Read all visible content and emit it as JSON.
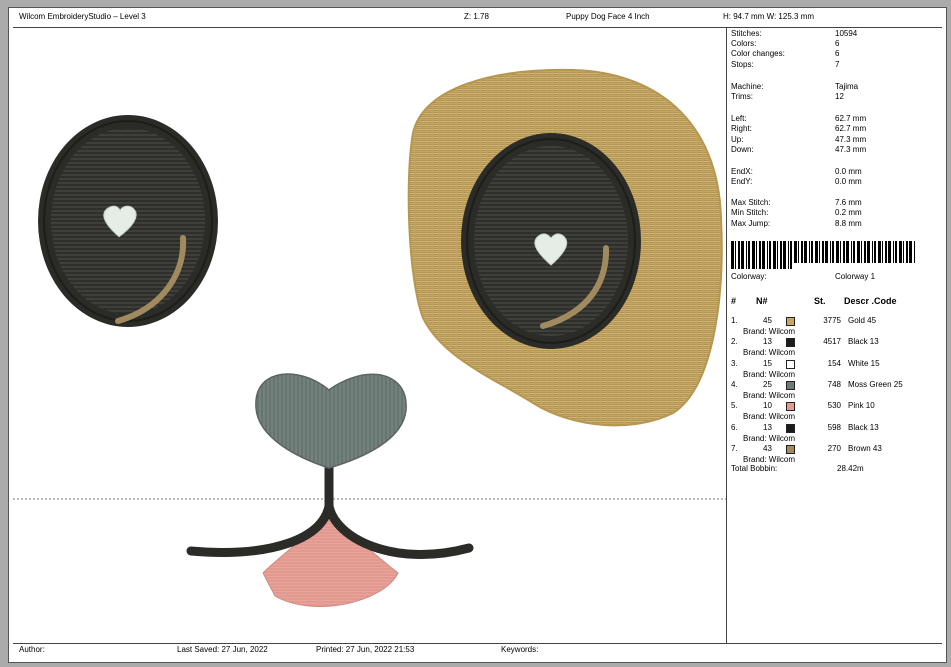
{
  "header": {
    "app_title": "Wilcom EmbroideryStudio – Level 3",
    "zoom": "Z: 1.78",
    "design_name": "Puppy Dog Face 4  Inch",
    "dimensions": "H: 94.7 mm   W: 125.3 mm"
  },
  "stats": [
    {
      "label": "Stitches:",
      "value": "10594"
    },
    {
      "label": "Colors:",
      "value": "6"
    },
    {
      "label": "Color changes:",
      "value": "6"
    },
    {
      "label": "Stops:",
      "value": "7"
    },
    {
      "label": "Machine:",
      "value": "Tajima"
    },
    {
      "label": "Trims:",
      "value": "12"
    },
    {
      "label": "Left:",
      "value": "62.7 mm"
    },
    {
      "label": "Right:",
      "value": "62.7 mm"
    },
    {
      "label": "Up:",
      "value": "47.3 mm"
    },
    {
      "label": "Down:",
      "value": "47.3 mm"
    },
    {
      "label": "EndX:",
      "value": "0.0 mm"
    },
    {
      "label": "EndY:",
      "value": "0.0 mm"
    },
    {
      "label": "Max Stitch:",
      "value": "7.6 mm"
    },
    {
      "label": "Min Stitch:",
      "value": "0.2 mm"
    },
    {
      "label": "Max Jump:",
      "value": "8.8 mm"
    }
  ],
  "colorway": {
    "label": "Colorway:",
    "value": "Colorway 1"
  },
  "table_headers": {
    "num": "#",
    "n": "N#",
    "st": "St.",
    "desc": "Descr .Code"
  },
  "colors": [
    {
      "idx": "1.",
      "n": "45",
      "st": "3775",
      "desc": "Gold 45",
      "brand": "Brand: Wilcom",
      "color": "#c8a560"
    },
    {
      "idx": "2.",
      "n": "13",
      "st": "4517",
      "desc": "Black 13",
      "brand": "Brand: Wilcom",
      "color": "#1b1b1b"
    },
    {
      "idx": "3.",
      "n": "15",
      "st": "154",
      "desc": "White 15",
      "brand": "Brand: Wilcom",
      "color": "#ffffff"
    },
    {
      "idx": "4.",
      "n": "25",
      "st": "748",
      "desc": "Moss Green 25",
      "brand": "Brand: Wilcom",
      "color": "#6f7a74"
    },
    {
      "idx": "5.",
      "n": "10",
      "st": "530",
      "desc": "Pink 10",
      "brand": "Brand: Wilcom",
      "color": "#e39a90"
    },
    {
      "idx": "6.",
      "n": "13",
      "st": "598",
      "desc": "Black 13",
      "brand": "Brand: Wilcom",
      "color": "#1b1b1b"
    },
    {
      "idx": "7.",
      "n": "43",
      "st": "270",
      "desc": "Brown 43",
      "brand": "Brand: Wilcom",
      "color": "#a08a5e"
    }
  ],
  "total_bobbin": {
    "label": "Total Bobbin:",
    "value": "28.42m"
  },
  "footer": {
    "author": "Author:",
    "last_saved": "Last Saved: 27 Jun, 2022",
    "printed": "Printed: 27 Jun, 2022 21:53",
    "keywords": "Keywords:"
  },
  "palette": {
    "gold": "#c8a865",
    "black": "#2b2b27",
    "nose": "#6f7c79",
    "pink": "#e8a39a",
    "white": "#e6ede6"
  }
}
